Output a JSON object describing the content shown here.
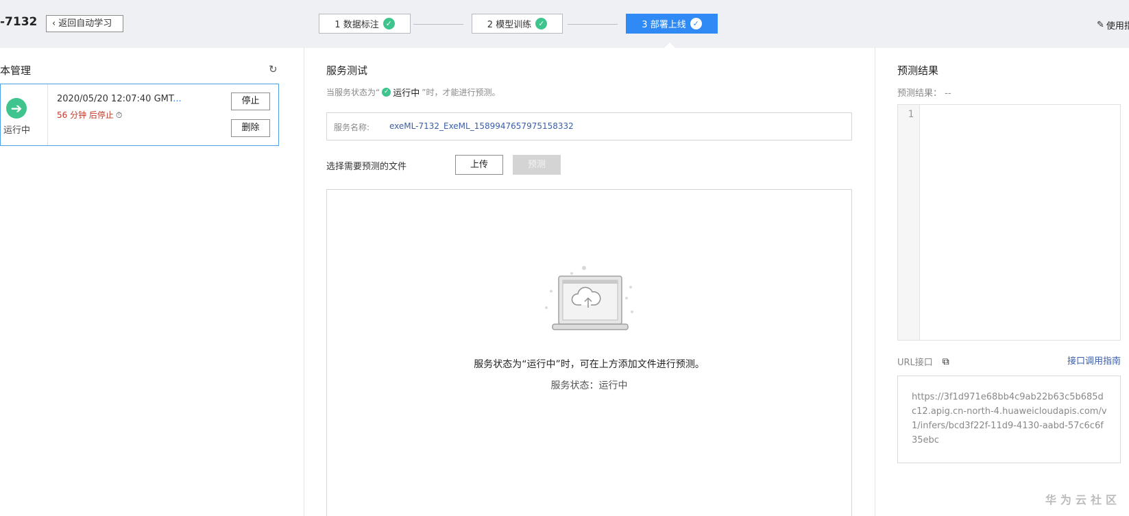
{
  "header": {
    "project_name": "-7132",
    "back_label": "返回自动学习",
    "steps": [
      {
        "label": "1 数据标注",
        "done": true
      },
      {
        "label": "2 模型训练",
        "done": true
      },
      {
        "label": "3 部署上线",
        "done": true,
        "active": true
      }
    ],
    "guide_label": "使用指"
  },
  "left_panel": {
    "title": "本管理",
    "version": {
      "status": "运行中",
      "time": "2020/05/20 12:07:40 GMT",
      "time_ellipsis": "...",
      "stop_info": "56 分钟 后停止",
      "stop_button": "停止",
      "delete_button": "删除"
    }
  },
  "middle_panel": {
    "title": "服务测试",
    "hint_prefix": "当服务状态为“",
    "hint_status": "运行中",
    "hint_suffix": "”时，才能进行预测。",
    "service_name_label": "服务名称:",
    "service_name_value": "exeML-7132_ExeML_1589947657975158332",
    "file_label": "选择需要预测的文件",
    "upload_button": "上传",
    "predict_button": "预测",
    "drop_message": "服务状态为“运行中”时，可在上方添加文件进行预测。",
    "drop_status": "服务状态：运行中"
  },
  "right_panel": {
    "title": "预测结果",
    "result_label": "预测结果：",
    "result_value": "--",
    "editor_line": "1",
    "url_label": "URL接口",
    "api_guide_link": "接口调用指南",
    "url": "https://3f1d971e68bb4c9ab22b63c5b685dc12.apig.cn-north-4.huaweicloudapis.com/v1/infers/bcd3f22f-11d9-4130-aabd-57c6c6f35ebc"
  },
  "watermark": "华为云社区",
  "colors": {
    "accent": "#2f8af5",
    "success": "#3ec48c",
    "warning_text": "#c0392b",
    "link": "#3a5ea8"
  }
}
